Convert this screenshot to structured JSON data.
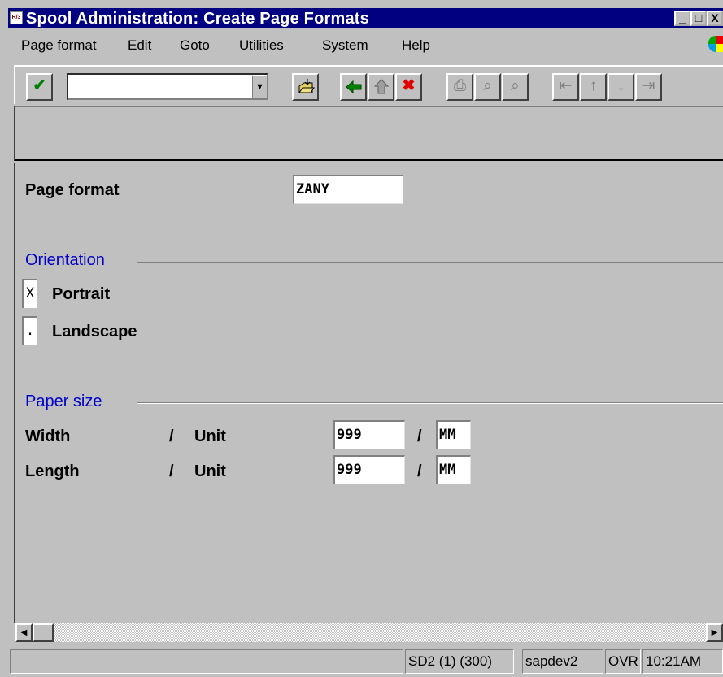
{
  "window": {
    "title": "Spool Administration: Create Page Formats",
    "icon_label": "R/3",
    "controls": [
      "_",
      "□",
      "X"
    ]
  },
  "menu": [
    "Page format",
    "Edit",
    "Goto",
    "Utilities",
    "System",
    "Help"
  ],
  "toolbar": {
    "command_field_value": "",
    "icons": [
      "enter-icon",
      "save-icon",
      "back-icon",
      "exit-icon",
      "cancel-icon",
      "print-icon",
      "find-icon",
      "find-next-icon",
      "first-page-icon",
      "previous-page-icon",
      "next-page-icon",
      "last-page-icon"
    ]
  },
  "form": {
    "page_format_label": "Page format",
    "page_format_value": "ZANY",
    "orientation": {
      "title": "Orientation",
      "portrait_label": "Portrait",
      "portrait_value": "X",
      "landscape_label": "Landscape",
      "landscape_value": "."
    },
    "paper_size": {
      "title": "Paper size",
      "separator": "/",
      "rows": [
        {
          "label": "Width",
          "unit_label": "Unit",
          "value": "999",
          "unit": "MM"
        },
        {
          "label": "Length",
          "unit_label": "Unit",
          "value": "999",
          "unit": "MM"
        }
      ]
    }
  },
  "status": {
    "message": "",
    "system": "SD2 (1) (300)",
    "server": "sapdev2",
    "mode": "OVR",
    "time": "10:21AM"
  },
  "colors": {
    "titlebar": "#000080",
    "group_title": "#0000c8",
    "face": "#c0c0c0"
  }
}
